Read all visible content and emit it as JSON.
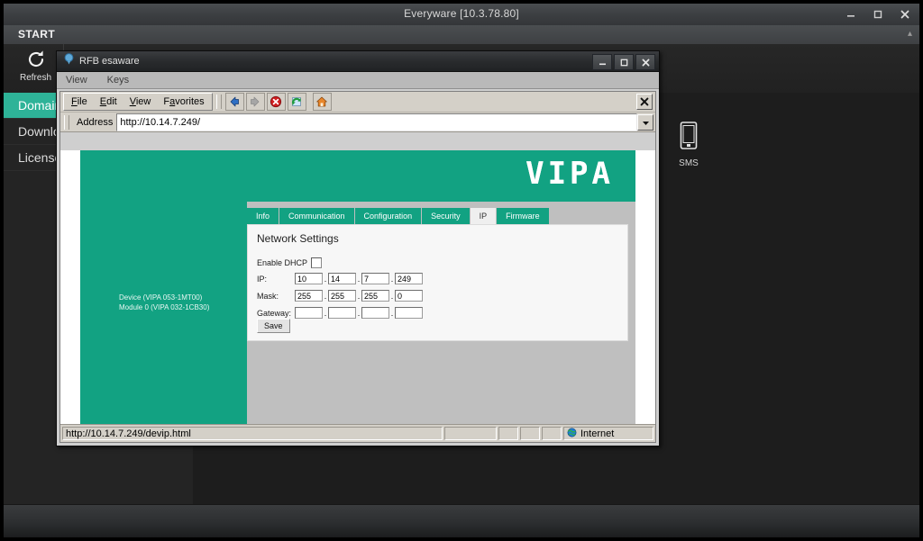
{
  "app": {
    "title": "Everyware [10.3.78.80]",
    "start_label": "START",
    "collapse_caret": "▴",
    "window_buttons": [
      {
        "name": "minimize",
        "label": "–"
      },
      {
        "name": "maximize",
        "label": "❑"
      },
      {
        "name": "close",
        "label": "✕"
      }
    ],
    "ribbon": {
      "refresh_label": "Refresh",
      "refresh_icon": "refresh-circular-arrow-icon"
    },
    "nav": {
      "items": [
        {
          "label": "Domain",
          "active": true
        },
        {
          "label": "Download",
          "active": false
        },
        {
          "label": "Licenses",
          "active": false
        }
      ]
    },
    "desktop": {
      "icons": [
        {
          "label": "SMS",
          "icon": "mobile-phone-icon"
        }
      ]
    }
  },
  "rfb": {
    "title": "RFB esaware",
    "title_icon": "rfb-balloon-icon",
    "window_buttons": [
      {
        "name": "minimize",
        "label": "–"
      },
      {
        "name": "maximize",
        "label": "❑"
      },
      {
        "name": "close",
        "label": "✕"
      }
    ],
    "menubar": [
      {
        "label": "View"
      },
      {
        "label": "Keys"
      }
    ]
  },
  "browser": {
    "menus": [
      {
        "label": "File",
        "mnemonic": "F"
      },
      {
        "label": "Edit",
        "mnemonic": "E"
      },
      {
        "label": "View",
        "mnemonic": "V"
      },
      {
        "label": "Favorites",
        "mnemonic": "a"
      }
    ],
    "toolbar_buttons": [
      {
        "name": "back-button",
        "icon": "back-arrow-icon",
        "enabled": true
      },
      {
        "name": "forward-button",
        "icon": "forward-arrow-icon",
        "enabled": false
      },
      {
        "name": "stop-button",
        "icon": "stop-icon",
        "enabled": true
      },
      {
        "name": "refresh-button",
        "icon": "refresh-icon",
        "enabled": true
      },
      {
        "name": "home-button",
        "icon": "home-icon",
        "enabled": true
      }
    ],
    "close_label": "✖",
    "address": {
      "label": "Address",
      "value": "http://10.14.7.249/",
      "placeholder": "http://",
      "dropdown_icon": "chevron-down-icon"
    },
    "statusbar": {
      "url": "http://10.14.7.249/devip.html",
      "zone": "Internet",
      "zone_icon": "globe-icon"
    }
  },
  "page": {
    "logo": "VIPA",
    "device_lines": [
      "Device (VIPA 053-1MT00)",
      "Module 0 (VIPA 032-1CB30)"
    ],
    "tabs": [
      {
        "label": "Info",
        "active": false
      },
      {
        "label": "Communication",
        "active": false
      },
      {
        "label": "Configuration",
        "active": false
      },
      {
        "label": "Security",
        "active": false
      },
      {
        "label": "IP",
        "active": true
      },
      {
        "label": "Firmware",
        "active": false
      }
    ],
    "panel_title": "Network Settings",
    "dhcp": {
      "label": "Enable DHCP",
      "checked": false
    },
    "ip": {
      "label": "IP:",
      "octets": [
        "10",
        "14",
        "7",
        "249"
      ]
    },
    "mask": {
      "label": "Mask:",
      "octets": [
        "255",
        "255",
        "255",
        "0"
      ]
    },
    "gateway": {
      "label": "Gateway:",
      "octets": [
        "",
        "",
        "",
        ""
      ]
    },
    "save_label": "Save",
    "accent_color": "#12a282"
  }
}
